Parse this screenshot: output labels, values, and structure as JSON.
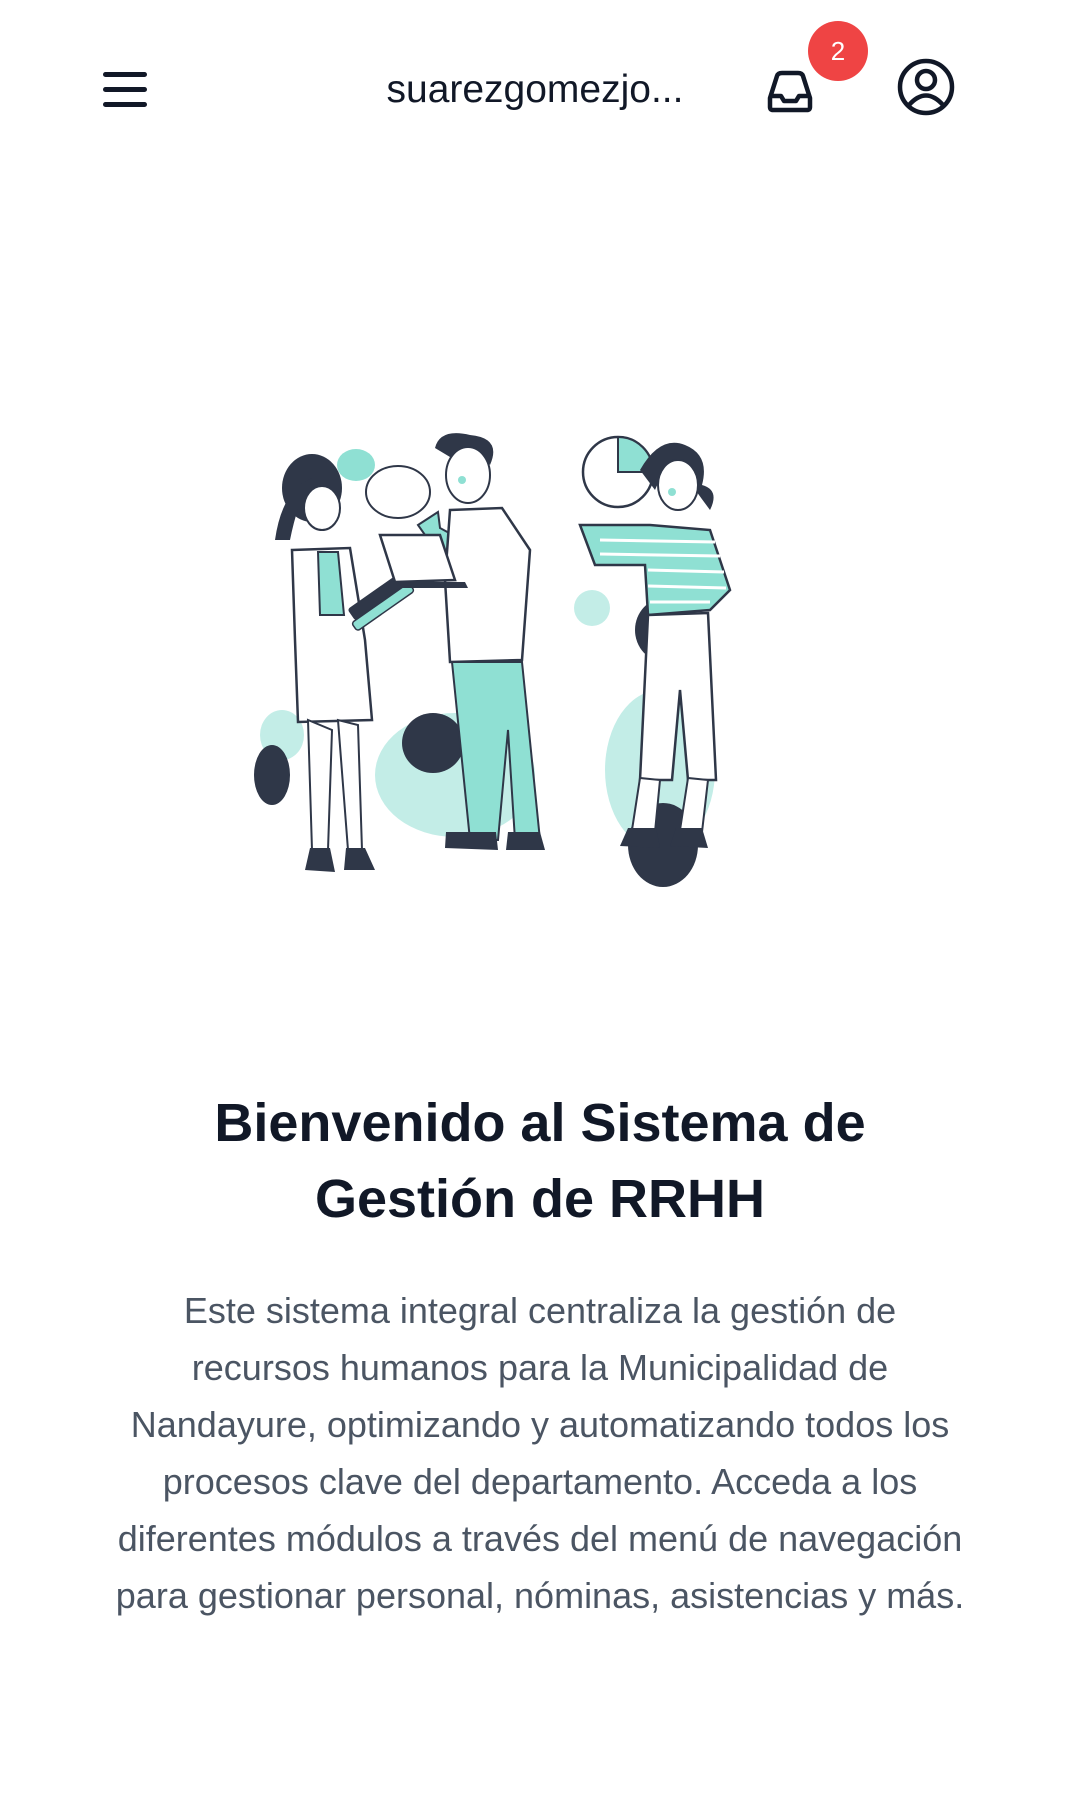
{
  "header": {
    "username": "suarezgomezjo...",
    "notifications_count": "2",
    "menu_icon": "hamburger-menu-icon",
    "inbox_icon": "inbox-tray-icon",
    "profile_icon": "user-circle-icon"
  },
  "main": {
    "title": "Bienvenido al Sistema de Gestión de RRHH",
    "description": "Este sistema integral centraliza la gestión de recursos humanos para la Municipalidad de Nandayure, optimizando y automatizando todos los procesos clave del departamento. Acceda a los diferentes módulos a través del menú de navegación para gestionar personal, nóminas, asistencias y más."
  },
  "colors": {
    "accent": "#8fe0d3",
    "accent_light": "#c3ede7",
    "dark": "#2f3748",
    "badge": "#ef4444",
    "text": "#111827",
    "muted_text": "#4b5563"
  }
}
